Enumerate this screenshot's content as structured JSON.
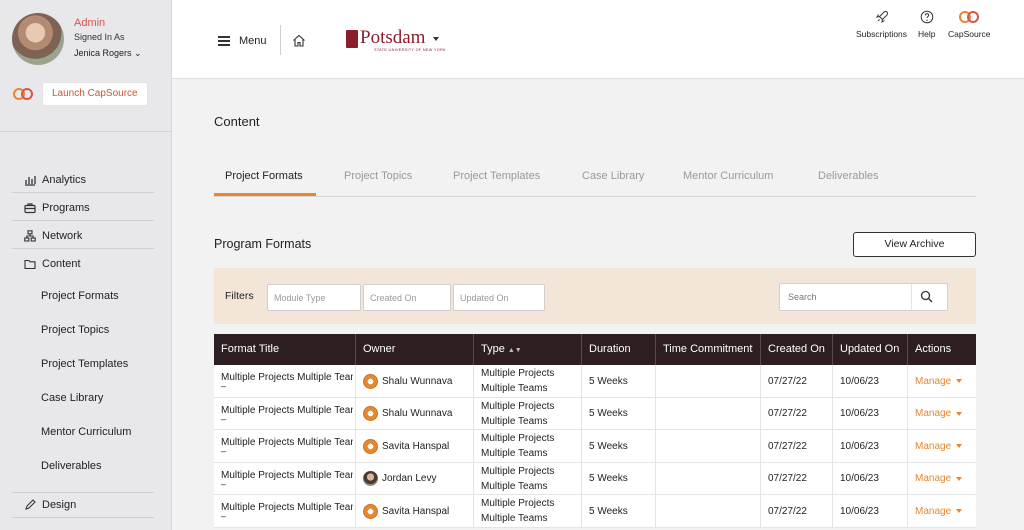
{
  "sidebar": {
    "user": {
      "role": "Admin",
      "signed_in_label": "Signed In As",
      "name": "Jenica Rogers ⌄"
    },
    "launch_label": "Launch CapSource",
    "nav": [
      {
        "label": "Analytics",
        "icon": "chart-icon"
      },
      {
        "label": "Programs",
        "icon": "briefcase-icon"
      },
      {
        "label": "Network",
        "icon": "network-icon"
      },
      {
        "label": "Content",
        "icon": "folder-icon"
      }
    ],
    "content_items": [
      "Project Formats",
      "Project Topics",
      "Project Templates",
      "Case Library",
      "Mentor Curriculum",
      "Deliverables"
    ],
    "design_label": "Design"
  },
  "topbar": {
    "menu_label": "Menu",
    "brand": {
      "name": "Potsdam",
      "subtitle": "STATE UNIVERSITY OF NEW YORK"
    },
    "links": [
      {
        "label": "Subscriptions",
        "icon": "rocket-icon"
      },
      {
        "label": "Help",
        "icon": "help-icon"
      },
      {
        "label": "CapSource",
        "icon": "capsource-logo-icon"
      }
    ]
  },
  "main": {
    "title": "Content",
    "tabs": [
      "Project Formats",
      "Project Topics",
      "Project Templates",
      "Case Library",
      "Mentor Curriculum",
      "Deliverables"
    ],
    "active_tab": "Project Formats",
    "section_title": "Program Formats",
    "view_archive_label": "View Archive",
    "filters": {
      "label": "Filters",
      "module_type_placeholder": "Module Type",
      "created_on_placeholder": "Created On",
      "updated_on_placeholder": "Updated On",
      "search_placeholder": "Search"
    },
    "table": {
      "columns": [
        "Format Title",
        "Owner",
        "Type",
        "Duration",
        "Time Commitment",
        "Created On",
        "Updated On",
        "Actions"
      ],
      "rows": [
        {
          "title": "Multiple Projects Multiple Teams",
          "dash": "–",
          "owner": "Shalu Wunnava",
          "avatar": "generic",
          "type1": "Multiple Projects",
          "type2": "Multiple Teams",
          "duration": "5 Weeks",
          "time": "",
          "created": "07/27/22",
          "updated": "10/06/23",
          "action": "Manage"
        },
        {
          "title": "Multiple Projects Multiple Teams",
          "dash": "–",
          "owner": "Shalu Wunnava",
          "avatar": "generic",
          "type1": "Multiple Projects",
          "type2": "Multiple Teams",
          "duration": "5 Weeks",
          "time": "",
          "created": "07/27/22",
          "updated": "10/06/23",
          "action": "Manage"
        },
        {
          "title": "Multiple Projects Multiple Teams",
          "dash": "–",
          "owner": "Savita Hanspal",
          "avatar": "generic",
          "type1": "Multiple Projects",
          "type2": "Multiple Teams",
          "duration": "5 Weeks",
          "time": "",
          "created": "07/27/22",
          "updated": "10/06/23",
          "action": "Manage"
        },
        {
          "title": "Multiple Projects Multiple Teams",
          "dash": "–",
          "owner": "Jordan Levy",
          "avatar": "photo",
          "type1": "Multiple Projects",
          "type2": "Multiple Teams",
          "duration": "5 Weeks",
          "time": "",
          "created": "07/27/22",
          "updated": "10/06/23",
          "action": "Manage"
        },
        {
          "title": "Multiple Projects Multiple Teams",
          "dash": "–",
          "owner": "Savita Hanspal",
          "avatar": "generic",
          "type1": "Multiple Projects",
          "type2": "Multiple Teams",
          "duration": "5 Weeks",
          "time": "",
          "created": "07/27/22",
          "updated": "10/06/23",
          "action": "Manage"
        }
      ]
    }
  },
  "colors": {
    "accent": "#e8872f",
    "table_header": "#2e1e22",
    "brand": "#8b1e2d",
    "filter_bg": "#f3e6d8"
  }
}
